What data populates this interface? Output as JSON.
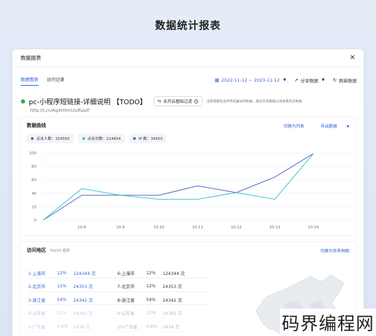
{
  "page": {
    "heading": "数据统计报表"
  },
  "modal": {
    "title": "数据报表",
    "close_icon": "close-icon"
  },
  "tabs": [
    {
      "label": "数据图表",
      "active": true
    },
    {
      "label": "访问记录",
      "active": false
    }
  ],
  "tools": {
    "date_range": "2022-11-12 ~ 2023-11-12",
    "share": "分享数据",
    "refresh": "刷新数据"
  },
  "link": {
    "title": "pc-小程序短链接-详细说明 【TODO】",
    "url": "http://t.cn/AipkHHmUsdfasdf",
    "filter_button": "未开启基础过滤",
    "filter_note": "当前短链包含所有机器访问数据，建议开启基础过滤查看真实数据"
  },
  "curve": {
    "title": "数据曲线",
    "switch_list": "切换为列表",
    "export": "导出数据",
    "legend": [
      {
        "label": "点击人数：324555",
        "color": "#4a66c9"
      },
      {
        "label": "点击次数：214654",
        "color": "#3fc1c9"
      },
      {
        "label": "IP 数：34555",
        "color": "#4a66c9"
      }
    ]
  },
  "chart_data": {
    "type": "line",
    "x": [
      "",
      "10.8",
      "10.9",
      "10.10",
      "10.11",
      "10.12",
      "10.13",
      "10.14",
      ""
    ],
    "ylim": [
      0,
      100
    ],
    "yticks": [
      0,
      20,
      40,
      60,
      80,
      100
    ],
    "series": [
      {
        "color": "#4a66c9",
        "values": [
          0,
          37,
          37,
          37,
          51,
          41,
          64,
          99
        ]
      },
      {
        "color": "#3fc1c9",
        "values": [
          0,
          47,
          37,
          31,
          31,
          41,
          31,
          99
        ]
      }
    ]
  },
  "region": {
    "title": "访问地区",
    "subtitle": "Top10 省份",
    "switch_map": "切换为世界地图",
    "rows_left": [
      {
        "name": "1-上海市",
        "pct": "12%",
        "count": "124344 次"
      },
      {
        "name": "2-北京市",
        "pct": "12%",
        "count": "24353 次"
      },
      {
        "name": "3-浙江省",
        "pct": "54%",
        "count": "24342 次"
      },
      {
        "name": "4-山东省",
        "pct": "11%",
        "count": "24342 次"
      },
      {
        "name": "5-广东省",
        "pct": "0.6%",
        "count": "2434 次"
      }
    ],
    "rows_right": [
      {
        "name": "6-上海市",
        "pct": "12%",
        "count": "124344 次"
      },
      {
        "name": "7-北京市",
        "pct": "12%",
        "count": "24353 次"
      },
      {
        "name": "8-浙江省",
        "pct": "54%",
        "count": "24342 次"
      },
      {
        "name": "9-山东省",
        "pct": "11%",
        "count": "24342 次"
      },
      {
        "name": "10-广东省",
        "pct": "0.6%",
        "count": "2434 次"
      }
    ]
  },
  "watermark": "码界编程网"
}
